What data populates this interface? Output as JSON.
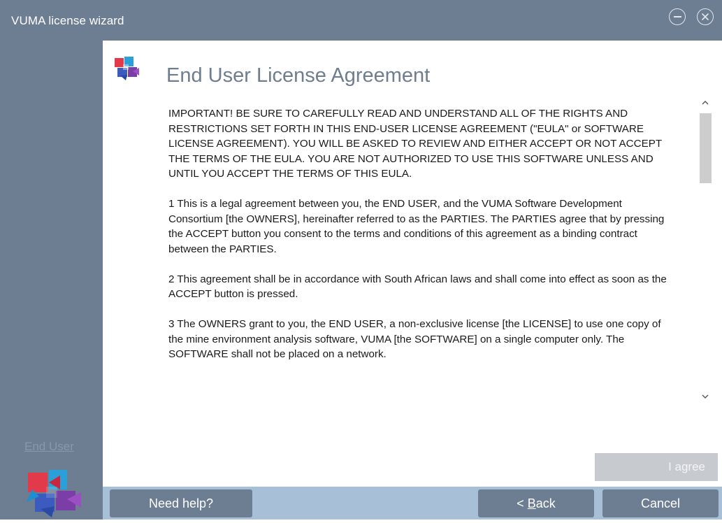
{
  "window": {
    "title": "VUMA license wizard",
    "icons": {
      "minimize": "minimize-circle-icon",
      "close": "close-circle-icon"
    }
  },
  "sidebar": {
    "step_link": "End User",
    "logo": "vuma-logo-icon"
  },
  "header": {
    "title": "End User License Agreement",
    "logo": "vuma-logo-icon"
  },
  "license": {
    "paragraphs": [
      "IMPORTANT! BE SURE TO CAREFULLY READ AND UNDERSTAND ALL OF THE RIGHTS AND RESTRICTIONS SET FORTH IN THIS END-USER LICENSE AGREEMENT (\"EULA\" or SOFTWARE LICENSE AGREEMENT). YOU WILL BE ASKED TO REVIEW AND EITHER ACCEPT OR NOT ACCEPT THE TERMS OF THE EULA. YOU ARE NOT AUTHORIZED TO USE THIS SOFTWARE UNLESS AND UNTIL YOU ACCEPT THE TERMS OF THIS EULA.",
      "1 This is a legal agreement between you, the END USER, and the VUMA Software Development Consortium [the OWNERS], hereinafter referred to as the PARTIES. The PARTIES agree that by pressing the ACCEPT button you consent to the terms and conditions of this agreement as a binding contract between the PARTIES.",
      "2 This agreement shall be in accordance with South African laws and shall come into effect as soon as the ACCEPT button is pressed.",
      "3 The OWNERS grant to you, the END USER, a non-exclusive license [the LICENSE] to use one copy of the mine environment analysis software, VUMA [the SOFTWARE] on a single computer only. The SOFTWARE shall not be placed on a network."
    ],
    "scroll_icons": {
      "up": "chevron-up-icon",
      "down": "chevron-down-icon"
    }
  },
  "buttons": {
    "agree": "I agree",
    "help": "Need help?",
    "back_prefix": "< ",
    "back_accel": "B",
    "back_rest": "ack",
    "cancel": "Cancel"
  },
  "colors": {
    "chrome": "#6d7d92",
    "footer": "#a7c0d8",
    "title_text": "#6f7d8e",
    "disabled_button": "#c7cbd0"
  }
}
